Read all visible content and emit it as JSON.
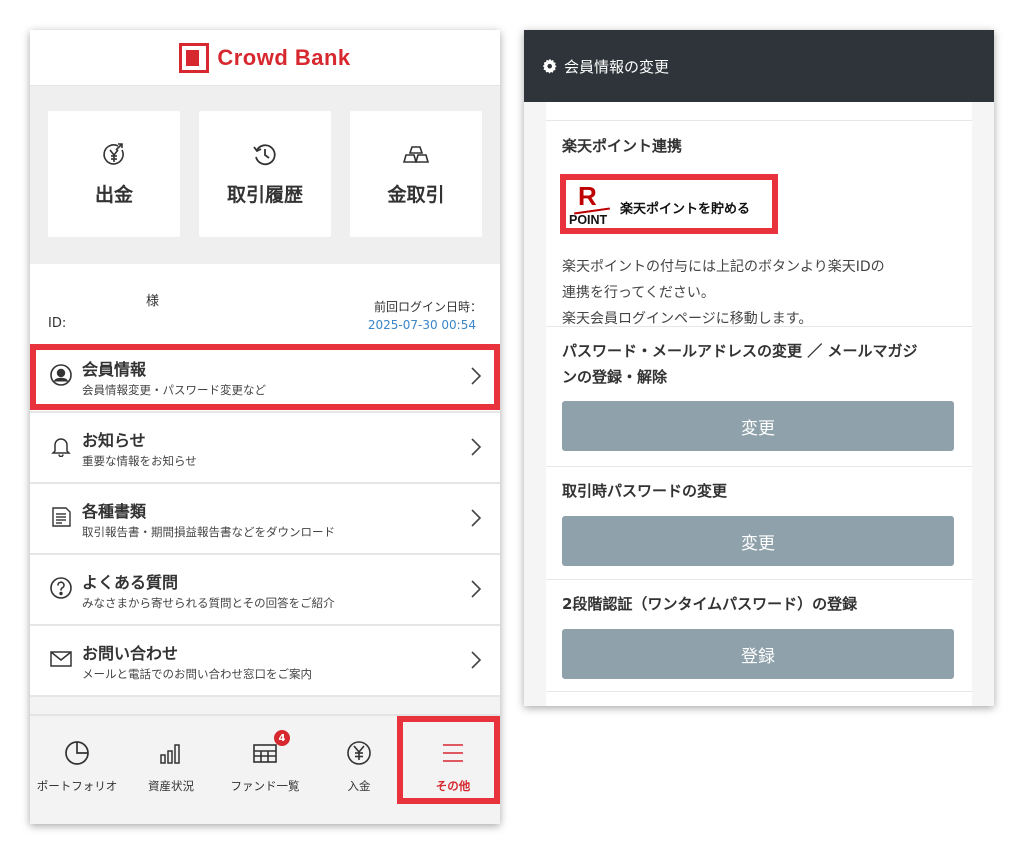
{
  "left": {
    "header": {
      "brand": "Crowd Bank"
    },
    "quick_actions": [
      {
        "label": "出金",
        "icon": "yen-withdraw-icon"
      },
      {
        "label": "取引履歴",
        "icon": "history-icon"
      },
      {
        "label": "金取引",
        "icon": "gold-bars-icon"
      }
    ],
    "user_info": {
      "honorific": "様",
      "id_label": "ID:",
      "last_login_label": "前回ログイン日時：",
      "last_login_value": "2025-07-30 00:54"
    },
    "menu": [
      {
        "title": "会員情報",
        "subtitle": "会員情報変更・パスワード変更など",
        "icon": "user-icon"
      },
      {
        "title": "お知らせ",
        "subtitle": "重要な情報をお知らせ",
        "icon": "bell-icon"
      },
      {
        "title": "各種書類",
        "subtitle": "取引報告書・期間損益報告書などをダウンロード",
        "icon": "document-icon"
      },
      {
        "title": "よくある質問",
        "subtitle": "みなさまから寄せられる質問とその回答をご紹介",
        "icon": "question-icon"
      },
      {
        "title": "お問い合わせ",
        "subtitle": "メールと電話でのお問い合わせ窓口をご案内",
        "icon": "mail-icon"
      }
    ],
    "bottom_nav": [
      {
        "label": "ポートフォリオ",
        "icon": "pie-chart-icon"
      },
      {
        "label": "資産状況",
        "icon": "bar-chart-icon"
      },
      {
        "label": "ファンド一覧",
        "icon": "fund-list-icon",
        "badge": "4"
      },
      {
        "label": "入金",
        "icon": "yen-circle-icon"
      },
      {
        "label": "その他",
        "icon": "menu-icon",
        "active": true
      }
    ]
  },
  "right": {
    "header": {
      "title": "会員情報の変更"
    },
    "rakuten": {
      "title": "楽天ポイント連携",
      "logo_letter": "R",
      "logo_point": "POINT",
      "button_label": "楽天ポイントを貯める",
      "desc_lines": [
        "楽天ポイントの付与には上記のボタンより楽天IDの",
        "連携を行ってください。",
        "楽天会員ログインページに移動します。"
      ]
    },
    "password_email": {
      "title_lines": [
        "パスワード・メールアドレスの変更 ／ メールマガジ",
        "ンの登録・解除"
      ],
      "button_label": "変更"
    },
    "trade_password": {
      "title": "取引時パスワードの変更",
      "button_label": "変更"
    },
    "two_factor": {
      "title": "2段階認証（ワンタイムパスワード）の登録",
      "button_label": "登録"
    }
  },
  "colors": {
    "brand_red": "#d7282f",
    "highlight_red": "#e8323c",
    "header_dark": "#2e3439",
    "button_grey": "#8fa1aa",
    "link_blue": "#3a86c8"
  }
}
